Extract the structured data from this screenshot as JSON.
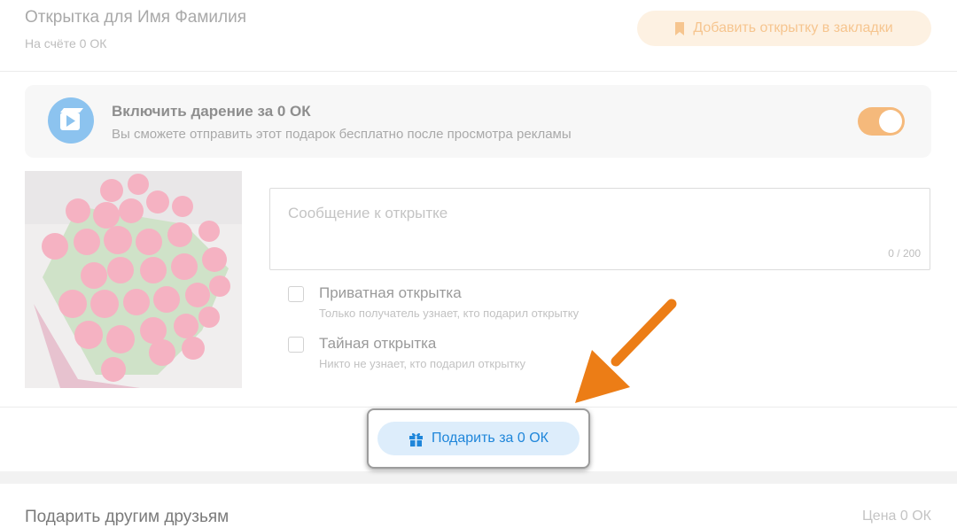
{
  "header": {
    "title": "Открытка для Имя Фамилия",
    "balance": "На счёте 0 ОК",
    "bookmark_button": "Добавить открытку в закладки"
  },
  "ad_gift": {
    "title": "Включить дарение за 0 ОК",
    "subtitle": "Вы сможете отправить этот подарок бесплатно после просмотра рекламы",
    "toggle_on": true,
    "icon": "video-ad-icon"
  },
  "card_image": {
    "subject": "bouquet-of-pink-roses"
  },
  "message": {
    "placeholder": "Сообщение к открытке",
    "value": "",
    "counter": "0 / 200"
  },
  "options": [
    {
      "title": "Приватная открытка",
      "subtitle": "Только получатель узнает, кто подарил открытку",
      "checked": false
    },
    {
      "title": "Тайная открытка",
      "subtitle": "Никто не узнает, кто подарил открытку",
      "checked": false
    }
  ],
  "gift_button": {
    "label": "Подарить за 0 ОК",
    "icon": "gift-icon"
  },
  "footer": {
    "title": "Подарить другим друзьям",
    "price": "Цена 0 ОК"
  },
  "colors": {
    "accent_orange": "#f5b97b",
    "annotation_arrow": "#ec7d16",
    "button_blue": "#1f86da",
    "button_blue_bg": "#ddedfb"
  }
}
